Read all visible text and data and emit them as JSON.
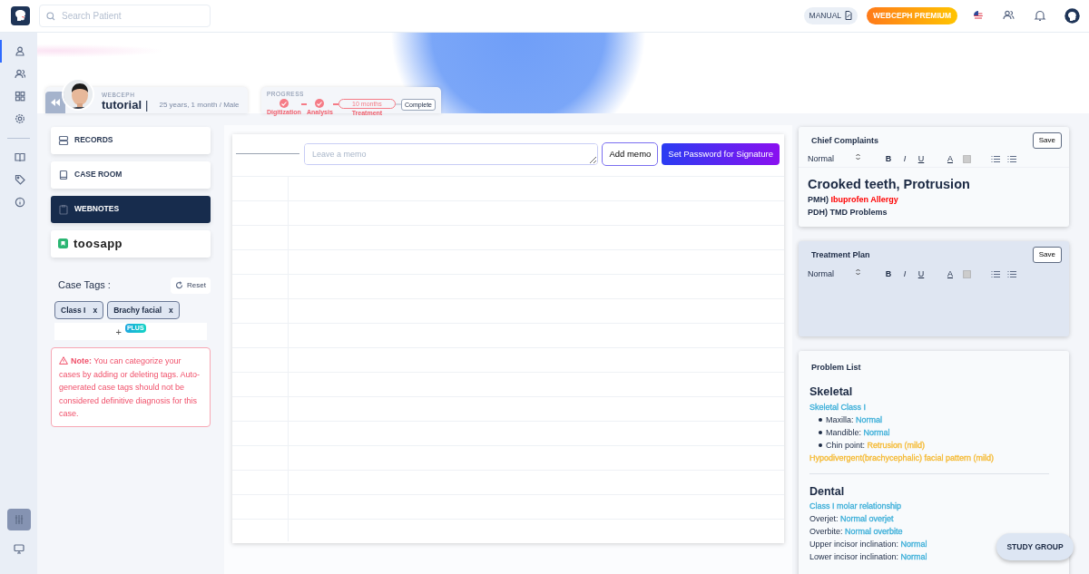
{
  "topbar": {
    "search": {
      "placeholder": "Search Patient"
    },
    "manual": "MANUAL",
    "premium": "WEBCEPH PREMIUM"
  },
  "rail": {
    "items": [
      {
        "selected": true
      },
      {
        "selected": false
      },
      {
        "selected": false
      },
      {
        "selected": false
      },
      {
        "selected": false
      },
      {
        "selected": false
      },
      {
        "selected": false
      }
    ],
    "tools": [
      {
        "selected": true
      },
      {
        "selected": false
      }
    ]
  },
  "patient": {
    "label": "WEBCEPH",
    "name": "tutorial",
    "separator": "|",
    "info": "25 years, 1 month / Male"
  },
  "progress": {
    "title": "PROGRESS",
    "steps": [
      {
        "kind": "done",
        "label": "Digitization"
      },
      {
        "kind": "done",
        "label": "Analysis"
      },
      {
        "kind": "current",
        "label": "Treatment",
        "duration": "10 months"
      },
      {
        "kind": "end",
        "text": "Complete"
      }
    ]
  },
  "menu": [
    {
      "kind": "item",
      "label": "RECORDS",
      "selected": false
    },
    {
      "kind": "item",
      "label": "CASE ROOM",
      "selected": false
    },
    {
      "kind": "item",
      "label": "WEBNOTES",
      "selected": true
    },
    {
      "kind": "logo",
      "label": "toosapp",
      "selected": false
    }
  ],
  "case_tags": {
    "title": "Case Tags :",
    "reset": "Reset",
    "tags": [
      {
        "label": "Class I",
        "remove": "x"
      },
      {
        "label": "Brachy facial",
        "remove": "x"
      }
    ],
    "add": "+",
    "add_badge": "PLUS",
    "note": "**Note:** You can categorize your cases by adding or deleting tags. Auto-generated case tags should not be considered definitive diagnosis for this case."
  },
  "memo": {
    "placeholder": "Leave a memo",
    "add_button": "Add memo",
    "signature_button": "Set Password for Signature"
  },
  "chief_complaints": {
    "title": "Chief Complaints",
    "save": "Save",
    "toolbar": {
      "format": "Normal",
      "marks": [
        "B",
        "I",
        "U",
        "A"
      ]
    },
    "heading": "Crooked teeth, Protrusion",
    "lines": [
      {
        "label": "PMH)",
        "value": "Ibuprofen Allergy",
        "color": "#ff0000"
      },
      {
        "label": "PDH) TMD Problems"
      }
    ]
  },
  "treatment_plan": {
    "title": "Treatment Plan",
    "save": "Save",
    "toolbar": {
      "format": "Normal",
      "marks": [
        "B",
        "I",
        "U",
        "A"
      ]
    }
  },
  "problem_list": {
    "title": "Problem List",
    "sections": [
      {
        "heading": "Skeletal",
        "lines": [
          {
            "kind": "finding",
            "value": "Skeletal Class I",
            "color": "#3aaed8"
          },
          {
            "kind": "bullet",
            "label": "Maxilla:",
            "value": "Normal",
            "color": "#3aaed8"
          },
          {
            "kind": "bullet",
            "label": "Mandible:",
            "value": "Normal",
            "color": "#3aaed8"
          },
          {
            "kind": "bullet",
            "label": "Chin point:",
            "value": "Retrusion  (mild)",
            "color": "#f5b82e"
          },
          {
            "kind": "finding",
            "value": "Hypodivergent(brachycephalic) facial pattern (mild)",
            "color": "#f5b82e"
          }
        ]
      },
      {
        "heading": "Dental",
        "lines": [
          {
            "kind": "finding",
            "value": "Class I molar relationship",
            "color": "#3aaed8"
          },
          {
            "kind": "pair",
            "label": "Overjet:",
            "value": "Normal overjet",
            "color": "#3aaed8"
          },
          {
            "kind": "pair",
            "label": "Overbite:",
            "value": "Normal overbite",
            "color": "#3aaed8"
          },
          {
            "kind": "pair",
            "label": "Upper incisor inclination:",
            "value": "Normal",
            "color": "#3aaed8"
          },
          {
            "kind": "pair",
            "label": "Lower incisor inclination:",
            "value": "Normal",
            "color": "#3aaed8"
          }
        ]
      }
    ]
  },
  "study_group": "STUDY GROUP"
}
